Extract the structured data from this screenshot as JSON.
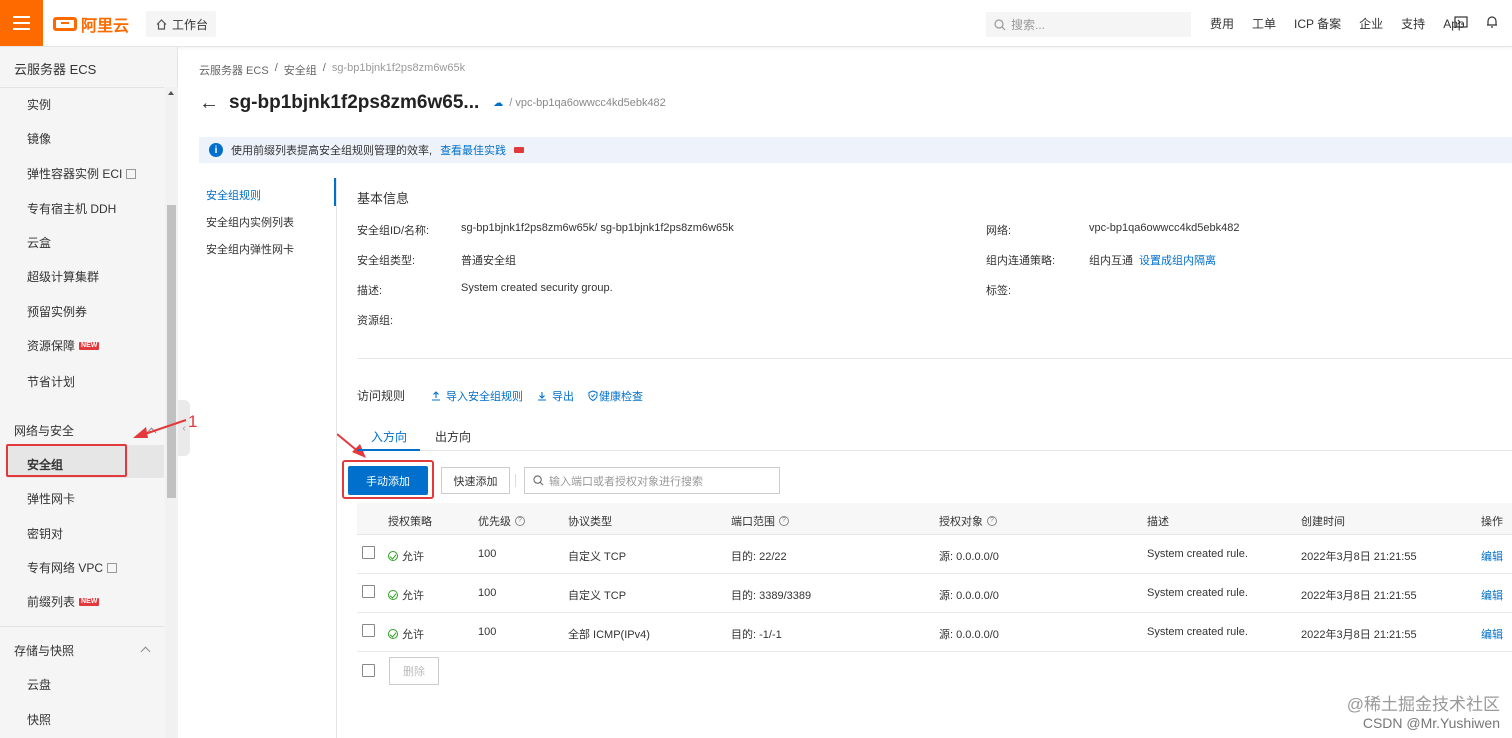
{
  "topbar": {
    "logo_text": "阿里云",
    "workbench_label": "工作台",
    "search_placeholder": "搜索...",
    "links": [
      "费用",
      "工单",
      "ICP 备案",
      "企业",
      "支持",
      "App"
    ]
  },
  "sidebar": {
    "title": "云服务器 ECS",
    "items_compute": [
      {
        "label": "实例"
      },
      {
        "label": "镜像"
      },
      {
        "label": "弹性容器实例 ECI",
        "external": true
      },
      {
        "label": "专有宿主机 DDH"
      },
      {
        "label": "云盒"
      },
      {
        "label": "超级计算集群"
      },
      {
        "label": "预留实例券"
      },
      {
        "label": "资源保障",
        "badge": "NEW"
      },
      {
        "label": "节省计划"
      }
    ],
    "group_network": "网络与安全",
    "items_network": [
      {
        "label": "安全组",
        "active": true
      },
      {
        "label": "弹性网卡"
      },
      {
        "label": "密钥对"
      },
      {
        "label": "专有网络 VPC",
        "external": true
      },
      {
        "label": "前缀列表",
        "badge": "NEW"
      }
    ],
    "group_storage": "存储与快照",
    "items_storage": [
      {
        "label": "云盘"
      },
      {
        "label": "快照"
      }
    ]
  },
  "annotation": {
    "number": "1",
    "color": "#e4393c"
  },
  "breadcrumb": [
    "云服务器 ECS",
    "安全组",
    "sg-bp1bjnk1f2ps8zm6w65k"
  ],
  "page": {
    "title": "sg-bp1bjnk1f2ps8zm6w65...",
    "vpc": "/ vpc-bp1qa6owwcc4kd5ebk482"
  },
  "tip": {
    "text": "使用前缀列表提高安全组规则管理的效率,",
    "link": "查看最佳实践"
  },
  "left_nav": [
    {
      "label": "安全组规则",
      "active": true
    },
    {
      "label": "安全组内实例列表"
    },
    {
      "label": "安全组内弹性网卡"
    }
  ],
  "basic": {
    "title": "基本信息",
    "id_label": "安全组ID/名称:",
    "id_value": "sg-bp1bjnk1f2ps8zm6w65k/ sg-bp1bjnk1f2ps8zm6w65k",
    "type_label": "安全组类型:",
    "type_value": "普通安全组",
    "desc_label": "描述:",
    "desc_value": "System created security group.",
    "rg_label": "资源组:",
    "net_label": "网络:",
    "net_value": "vpc-bp1qa6owwcc4kd5ebk482",
    "policy_label": "组内连通策略:",
    "policy_value": "组内互通",
    "policy_link": "设置成组内隔离",
    "tag_label": "标签:"
  },
  "rules": {
    "label": "访问规则",
    "import": "导入安全组规则",
    "export": "导出",
    "health": "健康检查",
    "tabs": [
      "入方向",
      "出方向"
    ],
    "btn_manual": "手动添加",
    "btn_quick": "快速添加",
    "search_placeholder": "输入端口或者授权对象进行搜索",
    "columns": [
      "授权策略",
      "优先级",
      "协议类型",
      "端口范围",
      "授权对象",
      "描述",
      "创建时间",
      "操作"
    ],
    "rows": [
      {
        "policy": "允许",
        "priority": "100",
        "protocol": "自定义 TCP",
        "port": "目的: 22/22",
        "source": "源: 0.0.0.0/0",
        "desc": "System created rule.",
        "time": "2022年3月8日 21:21:55",
        "action": "编辑"
      },
      {
        "policy": "允许",
        "priority": "100",
        "protocol": "自定义 TCP",
        "port": "目的: 3389/3389",
        "source": "源: 0.0.0.0/0",
        "desc": "System created rule.",
        "time": "2022年3月8日 21:21:55",
        "action": "编辑"
      },
      {
        "policy": "允许",
        "priority": "100",
        "protocol": "全部 ICMP(IPv4)",
        "port": "目的: -1/-1",
        "source": "源: 0.0.0.0/0",
        "desc": "System created rule.",
        "time": "2022年3月8日 21:21:55",
        "action": "编辑"
      }
    ],
    "btn_delete": "删除"
  },
  "watermark": {
    "line1": "@稀土掘金技术社区",
    "line2": "CSDN @Mr.Yushiwen"
  },
  "colors": {
    "brand": "#ff6a00",
    "link": "#0070cc",
    "annotation": "#e4393c",
    "success": "#2ea121"
  }
}
